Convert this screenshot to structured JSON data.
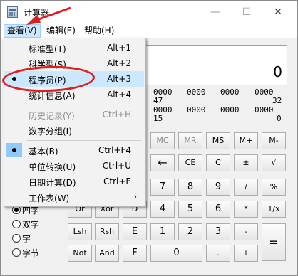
{
  "window": {
    "title": "计算器",
    "minimize": "—",
    "maximize": "☐",
    "close": "✕"
  },
  "menubar": {
    "view": "查看(V)",
    "edit": "编辑(E)",
    "help": "帮助(H)"
  },
  "display": {
    "value": "0"
  },
  "bits": {
    "row1": [
      "0000",
      "0000",
      "0000",
      "0000"
    ],
    "row1_marks": [
      "47",
      "32"
    ],
    "row2": [
      "0000",
      "0000",
      "0000",
      "0000"
    ],
    "row2_marks": [
      "15",
      "0"
    ]
  },
  "view_menu": {
    "items": [
      {
        "label": "标准型(T)",
        "shortcut": "Alt+1"
      },
      {
        "label": "科学型(S)",
        "shortcut": "Alt+2"
      },
      {
        "label": "程序员(P)",
        "shortcut": "Alt+3"
      },
      {
        "label": "统计信息(A)",
        "shortcut": "Alt+4"
      },
      {
        "label": "历史记录(Y)",
        "shortcut": "Ctrl+H"
      },
      {
        "label": "数字分组(I)",
        "shortcut": ""
      },
      {
        "label": "基本(B)",
        "shortcut": "Ctrl+F4"
      },
      {
        "label": "单位转换(U)",
        "shortcut": "Ctrl+U"
      },
      {
        "label": "日期计算(D)",
        "shortcut": "Ctrl+E"
      },
      {
        "label": "工作表(W)",
        "shortcut": ""
      }
    ],
    "submenu_arrow": "›"
  },
  "radios": [
    "四字",
    "双字",
    "字",
    "字节"
  ],
  "buttons": {
    "mc": "MC",
    "mr": "MR",
    "ms": "MS",
    "mplus": "M+",
    "mminus": "M-",
    "back": "←",
    "ce": "CE",
    "c": "C",
    "pm": "±",
    "sqrt": "√",
    "n7": "7",
    "n8": "8",
    "n9": "9",
    "div": "/",
    "pct": "%",
    "n4": "4",
    "n5": "5",
    "n6": "6",
    "mul": "*",
    "recip": "1/x",
    "n1": "1",
    "n2": "2",
    "n3": "3",
    "sub": "-",
    "eq": "=",
    "n0": "0",
    "dot": ".",
    "add": "+",
    "or": "Or",
    "xor": "Xor",
    "d": "D",
    "lsh": "Lsh",
    "rsh": "Rsh",
    "e": "E",
    "not": "Not",
    "and": "And",
    "f": "F"
  }
}
